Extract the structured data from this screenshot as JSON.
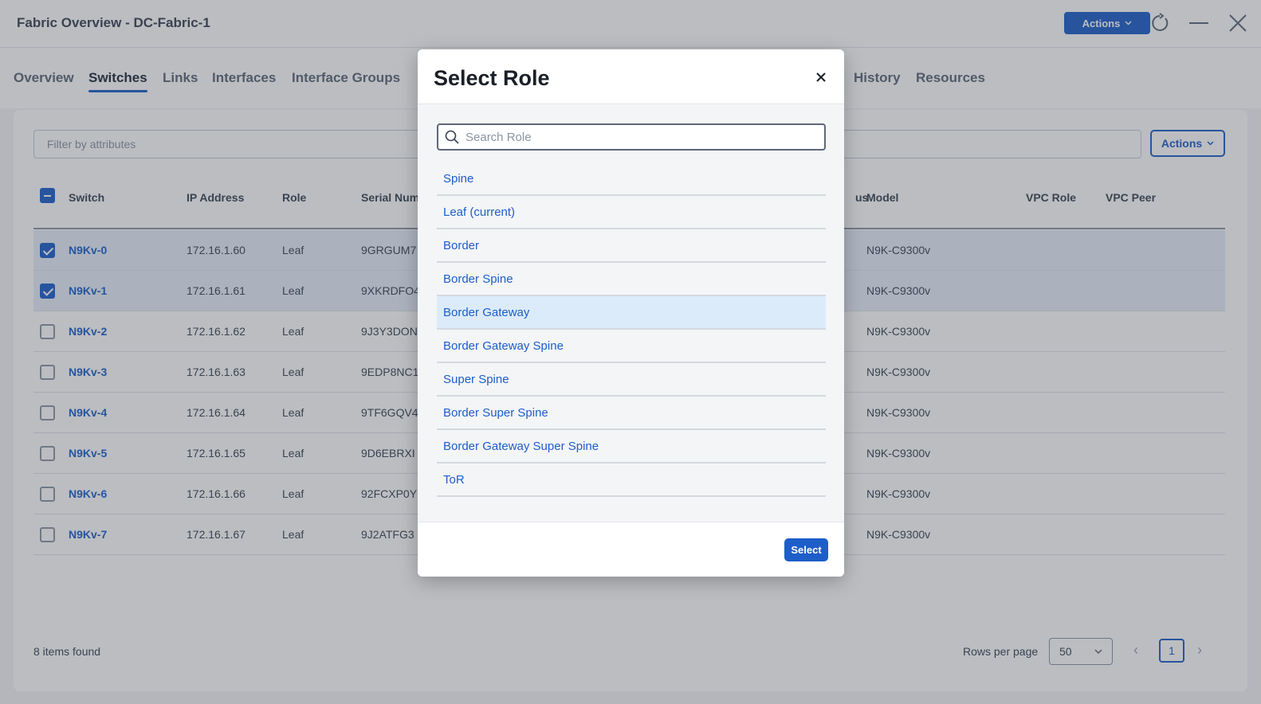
{
  "window": {
    "title": "Fabric Overview - DC-Fabric-1",
    "actions_label": "Actions"
  },
  "tabs": [
    {
      "label": "Overview"
    },
    {
      "label": "Switches"
    },
    {
      "label": "Links"
    },
    {
      "label": "Interfaces"
    },
    {
      "label": "Interface Groups"
    },
    {
      "label": "History"
    },
    {
      "label": "Resources"
    }
  ],
  "table": {
    "filter_placeholder": "Filter by attributes",
    "actions_label": "Actions",
    "columns": [
      "Switch",
      "IP Address",
      "Role",
      "Serial Num",
      "us",
      "Model",
      "VPC Role",
      "VPC Peer"
    ],
    "rows": [
      {
        "switch": "N9Kv-0",
        "ip": "172.16.1.60",
        "role": "Leaf",
        "serial": "9GRGUM7",
        "model": "N9K-C9300v",
        "checked": true
      },
      {
        "switch": "N9Kv-1",
        "ip": "172.16.1.61",
        "role": "Leaf",
        "serial": "9XKRDFO4",
        "model": "N9K-C9300v",
        "checked": true
      },
      {
        "switch": "N9Kv-2",
        "ip": "172.16.1.62",
        "role": "Leaf",
        "serial": "9J3Y3DON",
        "model": "N9K-C9300v",
        "checked": false
      },
      {
        "switch": "N9Kv-3",
        "ip": "172.16.1.63",
        "role": "Leaf",
        "serial": "9EDP8NC1",
        "model": "N9K-C9300v",
        "checked": false
      },
      {
        "switch": "N9Kv-4",
        "ip": "172.16.1.64",
        "role": "Leaf",
        "serial": "9TF6GQV4",
        "model": "N9K-C9300v",
        "checked": false
      },
      {
        "switch": "N9Kv-5",
        "ip": "172.16.1.65",
        "role": "Leaf",
        "serial": "9D6EBRXI",
        "model": "N9K-C9300v",
        "checked": false
      },
      {
        "switch": "N9Kv-6",
        "ip": "172.16.1.66",
        "role": "Leaf",
        "serial": "92FCXP0Y",
        "model": "N9K-C9300v",
        "checked": false
      },
      {
        "switch": "N9Kv-7",
        "ip": "172.16.1.67",
        "role": "Leaf",
        "serial": "9J2ATFG3",
        "model": "N9K-C9300v",
        "checked": false
      }
    ],
    "items_found": "8 items found",
    "rows_per_page_label": "Rows per page",
    "rows_per_page_value": "50",
    "current_page": "1"
  },
  "modal": {
    "title": "Select Role",
    "search_placeholder": "Search Role",
    "search_value": "",
    "roles": [
      {
        "label": "Spine"
      },
      {
        "label": "Leaf (current)"
      },
      {
        "label": "Border"
      },
      {
        "label": "Border Spine"
      },
      {
        "label": "Border Gateway",
        "hovered": true
      },
      {
        "label": "Border Gateway Spine"
      },
      {
        "label": "Super Spine"
      },
      {
        "label": "Border Super Spine"
      },
      {
        "label": "Border Gateway Super Spine"
      },
      {
        "label": "ToR"
      }
    ],
    "select_label": "Select"
  },
  "colors": {
    "accent": "#1d5ec8",
    "hover_row": "#dcebfa",
    "overlay": "rgba(60,66,78,0.35)"
  },
  "icons": {
    "refresh": "refresh-icon",
    "minimize": "minimize-icon",
    "close": "close-icon",
    "search": "search-icon",
    "chevron": "chevron-down-icon"
  }
}
